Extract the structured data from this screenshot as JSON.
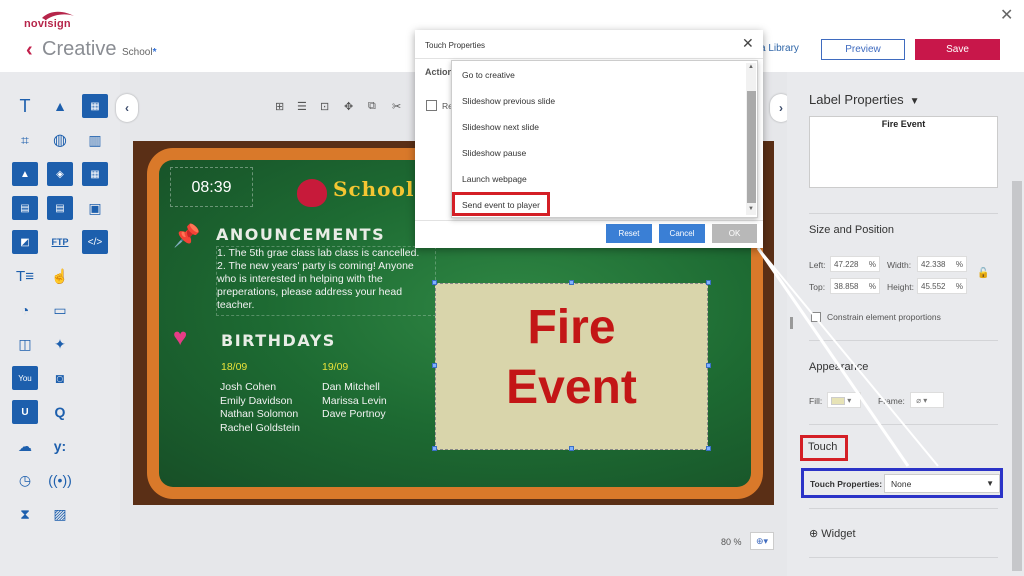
{
  "app": {
    "logo_text": "novisign",
    "title": "Creative",
    "file_name": "School",
    "file_modified_mark": "*",
    "media_library_link": "a Library",
    "preview_label": "Preview",
    "save_label": "Save"
  },
  "canvas": {
    "zoom": "80 %",
    "slide": {
      "clock": "08:39",
      "school_title": "School",
      "announcements_heading": "Anouncements",
      "announcements": [
        "1. The 5th grae class lab class is cancelled.",
        "2. The new years' party is coming! Anyone",
        "who is interested in helping with the",
        "preperations, please address your head",
        "teacher."
      ],
      "birthdays_heading": "Birthdays",
      "birthdays": [
        {
          "date": "18/09",
          "names": [
            "Josh Cohen",
            "Emily Davidson",
            "Nathan Solomon",
            "Rachel Goldstein"
          ]
        },
        {
          "date": "19/09",
          "names": [
            "Dan Mitchell",
            "Marissa Levin",
            "Dave Portnoy"
          ]
        }
      ],
      "fire_label_line1": "Fire",
      "fire_label_line2": "Event"
    }
  },
  "right_panel": {
    "title": "Label Properties",
    "label_text": "Fire Event",
    "size_position": {
      "heading": "Size and Position",
      "left_label": "Left:",
      "left_value": "47.228",
      "left_unit": "%",
      "top_label": "Top:",
      "top_value": "38.858",
      "top_unit": "%",
      "width_label": "Width:",
      "width_value": "42.338",
      "width_unit": "%",
      "height_label": "Height:",
      "height_value": "45.552",
      "height_unit": "%",
      "constrain_label": "Constrain element proportions"
    },
    "appearance": {
      "heading": "Appearance",
      "fill_label": "Fill:",
      "frame_label": "Frame:",
      "fill_color": "#e7e3b6"
    },
    "touch": {
      "heading": "Touch",
      "touch_properties_label": "Touch Properties:",
      "touch_properties_value": "None"
    },
    "widget_label": "Widget"
  },
  "dialog": {
    "title": "Touch Properties",
    "action_label": "Action",
    "checkbox_label": "Re",
    "dropdown_options": [
      "Go to creative",
      "Slideshow previous slide",
      "Slideshow next slide",
      "Slideshow pause",
      "Launch webpage",
      "Send event to player"
    ],
    "reset_label": "Reset",
    "cancel_label": "Cancel",
    "ok_label": "OK",
    "colors": {
      "primary": "#3a7fd5",
      "disabled": "#b8b8b8"
    }
  },
  "highlight_colors": {
    "red": "#d41f26",
    "blue": "#2b33c7"
  }
}
